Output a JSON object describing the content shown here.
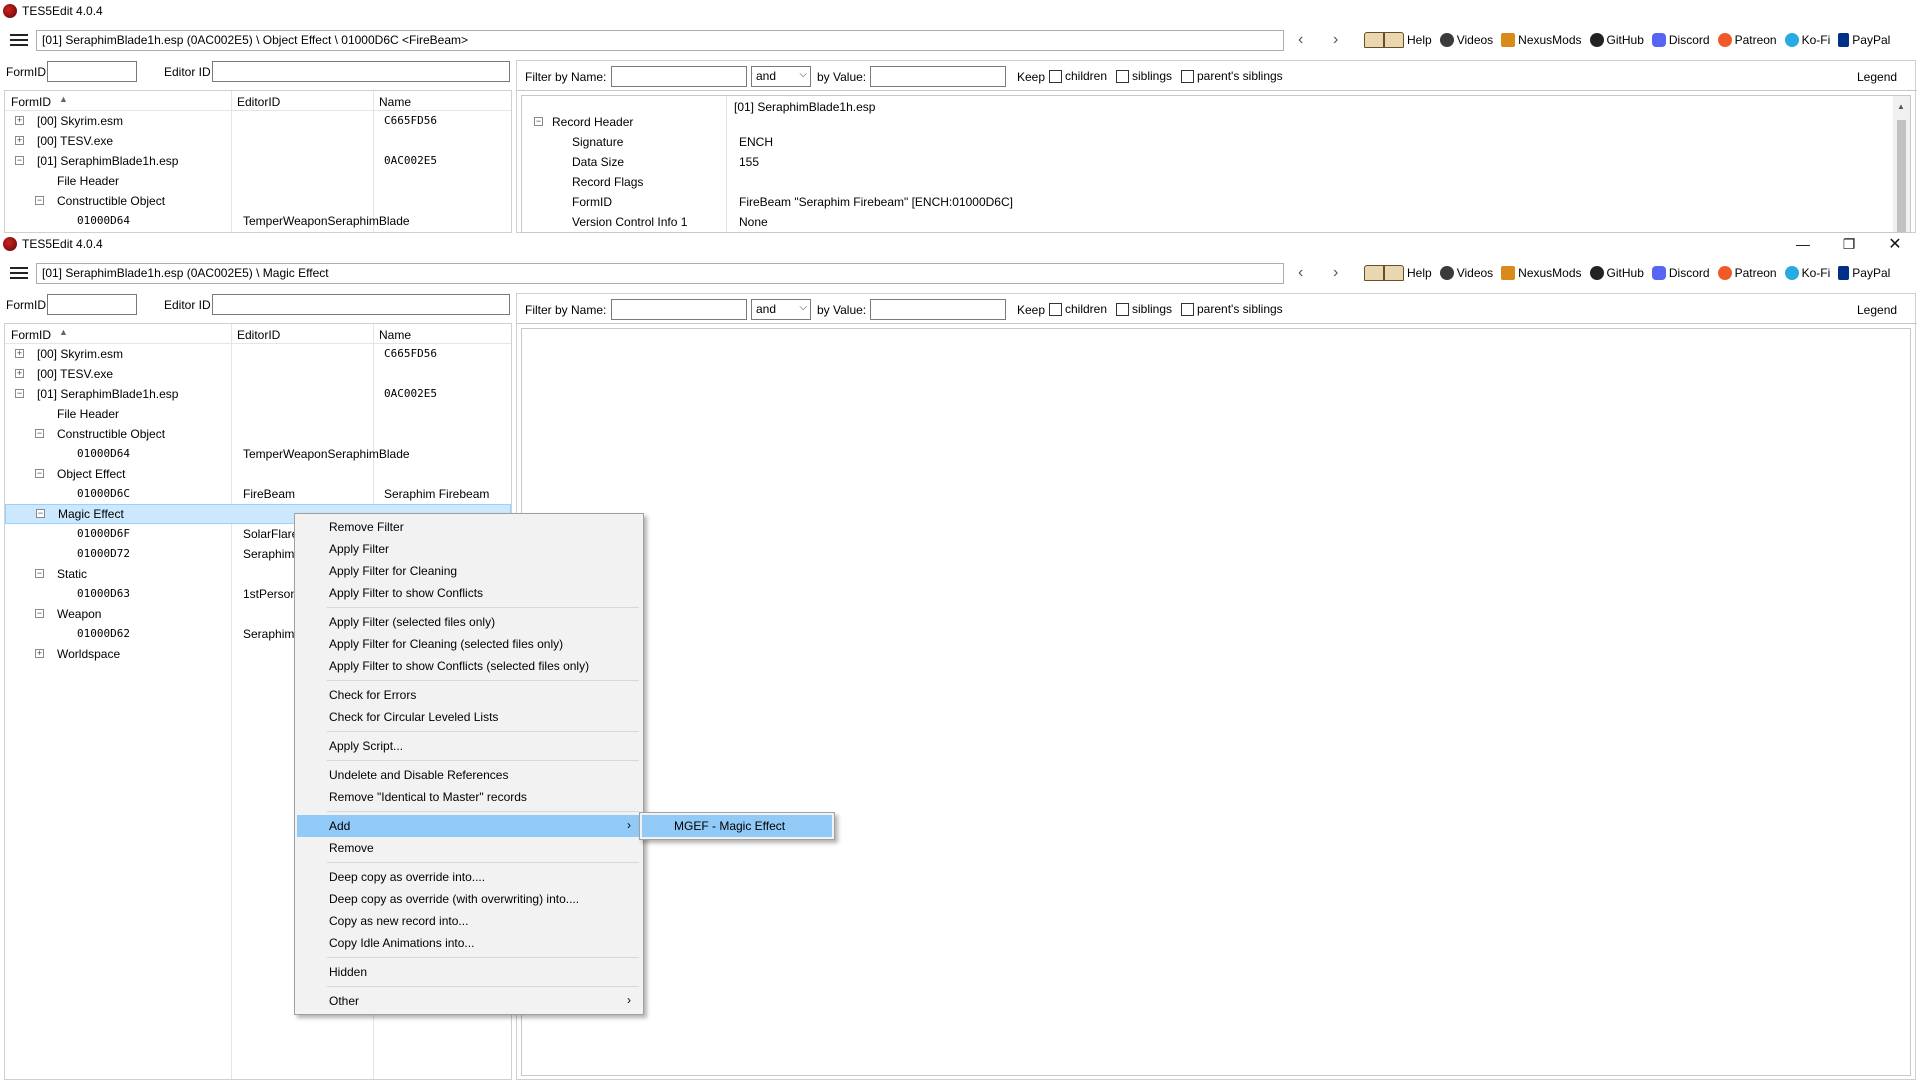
{
  "app_title": "TES5Edit 4.0.4",
  "window_controls": {
    "minimize": "—",
    "maximize": "❐",
    "close": "✕"
  },
  "toolbar_links": [
    "Help",
    "Videos",
    "NexusMods",
    "GitHub",
    "Discord",
    "Patreon",
    "Ko-Fi",
    "PayPal"
  ],
  "nav": {
    "back": "‹",
    "forward": "›"
  },
  "left_filter": {
    "formid_label": "FormID",
    "editorid_label": "Editor ID"
  },
  "right_filter": {
    "by_name_label": "Filter by Name:",
    "and_value": "and",
    "by_value_label": "by Value:",
    "keep_label": "Keep",
    "children": "children",
    "siblings": "siblings",
    "parents_siblings": "parent's siblings",
    "legend": "Legend"
  },
  "tree_columns": {
    "formid": "FormID",
    "editorid": "EditorID",
    "name": "Name"
  },
  "window1": {
    "path": "[01] SeraphimBlade1h.esp (0AC002E5) \\ Object Effect \\ 01000D6C <FireBeam>",
    "tree": [
      {
        "formid": "[00] Skyrim.esm",
        "editorid": "",
        "name": "C665FD56"
      },
      {
        "formid": "[00] TESV.exe",
        "editorid": "",
        "name": ""
      },
      {
        "formid": "[01] SeraphimBlade1h.esp",
        "editorid": "",
        "name": "0AC002E5"
      },
      {
        "formid": "File Header",
        "editorid": "",
        "name": ""
      },
      {
        "formid": "Constructible Object",
        "editorid": "",
        "name": ""
      },
      {
        "formid": "01000D64",
        "editorid": "TemperWeaponSeraphimBlade",
        "name": ""
      }
    ],
    "record": {
      "file_header": "[01] SeraphimBlade1h.esp",
      "rows": [
        {
          "key": "Record Header",
          "value": ""
        },
        {
          "key": "Signature",
          "value": "ENCH"
        },
        {
          "key": "Data Size",
          "value": "155"
        },
        {
          "key": "Record Flags",
          "value": ""
        },
        {
          "key": "FormID",
          "value": "FireBeam \"Seraphim Firebeam\" [ENCH:01000D6C]"
        },
        {
          "key": "Version Control Info 1",
          "value": "None"
        }
      ]
    }
  },
  "window2": {
    "path": "[01] SeraphimBlade1h.esp (0AC002E5) \\ Magic Effect",
    "tree": [
      {
        "formid": "[00] Skyrim.esm",
        "editorid": "",
        "name": "C665FD56"
      },
      {
        "formid": "[00] TESV.exe",
        "editorid": "",
        "name": ""
      },
      {
        "formid": "[01] SeraphimBlade1h.esp",
        "editorid": "",
        "name": "0AC002E5"
      },
      {
        "formid": "File Header",
        "editorid": "",
        "name": ""
      },
      {
        "formid": "Constructible Object",
        "editorid": "",
        "name": ""
      },
      {
        "formid": "01000D64",
        "editorid": "TemperWeaponSeraphimBlade",
        "name": ""
      },
      {
        "formid": "Object Effect",
        "editorid": "",
        "name": ""
      },
      {
        "formid": "01000D6C",
        "editorid": "FireBeam",
        "name": "Seraphim Firebeam"
      },
      {
        "formid": "Magic Effect",
        "editorid": "",
        "name": ""
      },
      {
        "formid": "01000D6F",
        "editorid": "SolarFlare",
        "name": ""
      },
      {
        "formid": "01000D72",
        "editorid": "Seraphim",
        "name": ""
      },
      {
        "formid": "Static",
        "editorid": "",
        "name": ""
      },
      {
        "formid": "01000D63",
        "editorid": "1stPerson",
        "name": ""
      },
      {
        "formid": "Weapon",
        "editorid": "",
        "name": ""
      },
      {
        "formid": "01000D62",
        "editorid": "Seraphim",
        "name": ""
      },
      {
        "formid": "Worldspace",
        "editorid": "",
        "name": ""
      }
    ]
  },
  "context_menu": {
    "items": [
      "Remove Filter",
      "Apply Filter",
      "Apply Filter for Cleaning",
      "Apply Filter to show Conflicts",
      "Apply Filter (selected files only)",
      "Apply Filter for Cleaning (selected files only)",
      "Apply Filter to show Conflicts (selected files only)",
      "Check for Errors",
      "Check for Circular Leveled Lists",
      "Apply Script...",
      "Undelete and Disable References",
      "Remove \"Identical to Master\" records",
      "Add",
      "Remove",
      "Deep copy as override into....",
      "Deep copy as override (with overwriting) into....",
      "Copy as new record into...",
      "Copy Idle Animations into...",
      "Hidden",
      "Other"
    ],
    "submenu_arrow": "›",
    "submenu": [
      "MGEF - Magic Effect"
    ]
  }
}
